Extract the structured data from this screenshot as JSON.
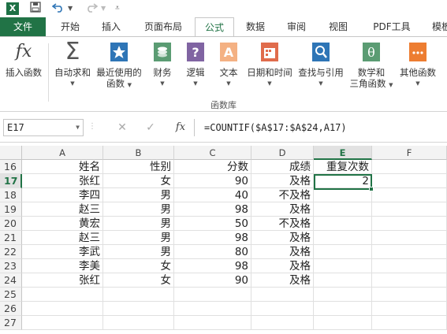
{
  "quick_access": {
    "app_badge": "X"
  },
  "tabs": [
    "文件",
    "开始",
    "插入",
    "页面布局",
    "公式",
    "数据",
    "审阅",
    "视图",
    "PDF工具",
    "模板"
  ],
  "ribbon": {
    "groups": [
      {
        "line1": "插入函数",
        "line2": ""
      },
      {
        "line1": "自动求和",
        "line2": ""
      },
      {
        "line1": "最近使用的",
        "line2": "函数"
      },
      {
        "line1": "财务",
        "line2": ""
      },
      {
        "line1": "逻辑",
        "line2": ""
      },
      {
        "line1": "文本",
        "line2": ""
      },
      {
        "line1": "日期和时间",
        "line2": ""
      },
      {
        "line1": "查找与引用",
        "line2": ""
      },
      {
        "line1": "数学和",
        "line2": "三角函数"
      },
      {
        "line1": "其他函数",
        "line2": ""
      }
    ],
    "group_label": "函数库",
    "icon_colors": {
      "fx": "#444444",
      "sigma": "#555555",
      "star": "#2e75b6",
      "finance": "#5b9c73",
      "logic": "#8064a2",
      "text": "#f4b183",
      "date": "#e06c4c",
      "lookup": "#2e75b6",
      "math": "#5b9c73",
      "more": "#ed7d31"
    }
  },
  "formula_bar": {
    "name_box": "E17",
    "cancel": "✕",
    "enter": "✓",
    "fx": "fx",
    "formula": "=COUNTIF($A$17:$A$24,A17)"
  },
  "sheet": {
    "columns": [
      "A",
      "B",
      "C",
      "D",
      "E",
      "F"
    ],
    "rows": [
      {
        "num": "16",
        "A": "姓名",
        "B": "性别",
        "C": "分数",
        "D": "成绩",
        "E": "重复次数"
      },
      {
        "num": "17",
        "A": "张红",
        "B": "女",
        "C": "90",
        "D": "及格",
        "E": "2"
      },
      {
        "num": "18",
        "A": "李四",
        "B": "男",
        "C": "40",
        "D": "不及格",
        "E": ""
      },
      {
        "num": "19",
        "A": "赵三",
        "B": "男",
        "C": "98",
        "D": "及格",
        "E": ""
      },
      {
        "num": "20",
        "A": "黄宏",
        "B": "男",
        "C": "50",
        "D": "不及格",
        "E": ""
      },
      {
        "num": "21",
        "A": "赵三",
        "B": "男",
        "C": "98",
        "D": "及格",
        "E": ""
      },
      {
        "num": "22",
        "A": "李武",
        "B": "男",
        "C": "80",
        "D": "及格",
        "E": ""
      },
      {
        "num": "23",
        "A": "李美",
        "B": "女",
        "C": "98",
        "D": "及格",
        "E": ""
      },
      {
        "num": "24",
        "A": "张红",
        "B": "女",
        "C": "90",
        "D": "及格",
        "E": ""
      },
      {
        "num": "25",
        "A": "",
        "B": "",
        "C": "",
        "D": "",
        "E": ""
      },
      {
        "num": "26",
        "A": "",
        "B": "",
        "C": "",
        "D": "",
        "E": ""
      },
      {
        "num": "27",
        "A": "",
        "B": "",
        "C": "",
        "D": "",
        "E": ""
      }
    ],
    "active_cell": "E17",
    "accent": "#217346"
  }
}
